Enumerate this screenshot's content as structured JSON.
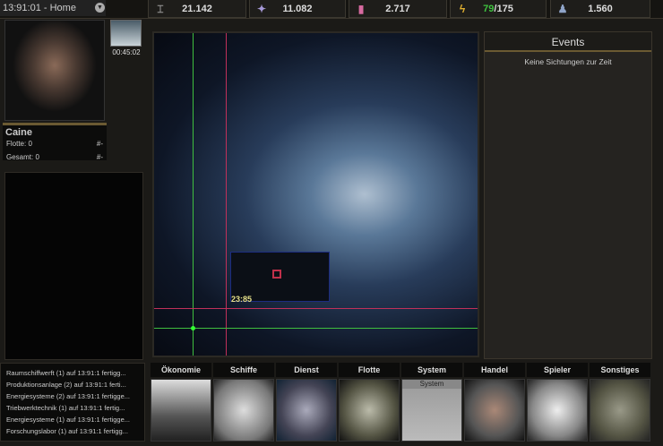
{
  "header": {
    "location": "13:91:01 - Home"
  },
  "resources": [
    {
      "icon": "metal-beam-icon",
      "value": "21.142"
    },
    {
      "icon": "crystal-icon",
      "value": "11.082"
    },
    {
      "icon": "vial-icon",
      "value": "2.717"
    },
    {
      "icon": "energy-icon",
      "value_used": "79",
      "value_total": "/175"
    },
    {
      "icon": "population-icon",
      "value": "1.560"
    }
  ],
  "player": {
    "name": "Caine",
    "fleet_label": "Flotte: 0",
    "fleet_rank": "#-",
    "total_label": "Gesamt: 0",
    "total_rank": "#-"
  },
  "build_timer": "00:45:02",
  "map": {
    "coords": "23:85"
  },
  "events": {
    "title": "Events",
    "message": "Keine Sichtungen zur Zeit"
  },
  "log": [
    "Raumschiffwerft (1) auf 13:91:1 fertigg...",
    "Produktionsanlage (2) auf 13:91:1 ferti...",
    "Energiesysteme (2) auf 13:91:1 fertigge...",
    "Triebwerktechnik (1) auf 13:91:1 fertig...",
    "Energiesysteme (1) auf 13:91:1 fertigge...",
    "Forschungslabor (1) auf 13:91:1 fertigg..."
  ],
  "nav": [
    {
      "label": "Ökonomie"
    },
    {
      "label": "Schiffe"
    },
    {
      "label": "Dienst"
    },
    {
      "label": "Flotte"
    },
    {
      "label": "System",
      "sub": "System"
    },
    {
      "label": "Handel"
    },
    {
      "label": "Spieler"
    },
    {
      "label": "Sonstiges"
    }
  ],
  "colors": {
    "energy_used": "#3fc23f",
    "accent": "#6b5a32"
  }
}
